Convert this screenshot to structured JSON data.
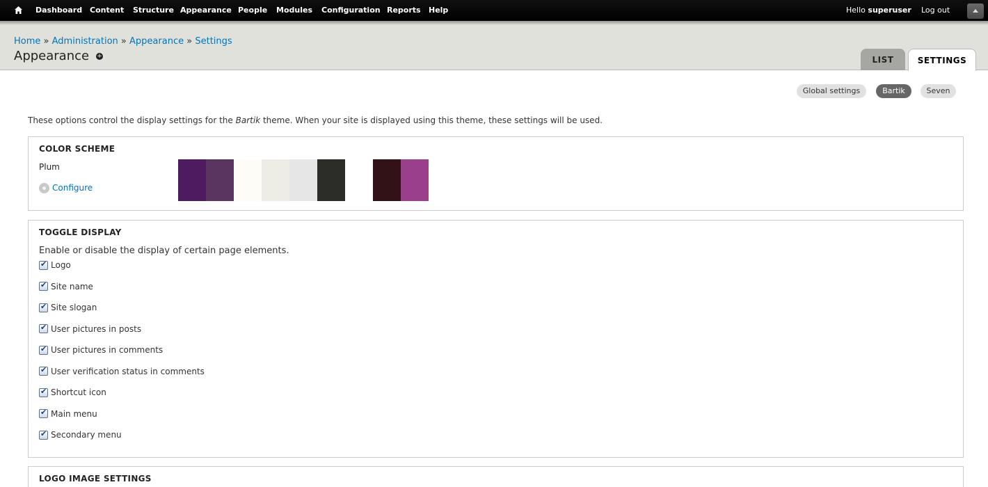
{
  "toolbar": {
    "menu": [
      "Dashboard",
      "Content",
      "Structure",
      "Appearance",
      "People",
      "Modules",
      "Configuration",
      "Reports",
      "Help"
    ],
    "hello_prefix": "Hello",
    "username": "superuser",
    "logout": "Log out"
  },
  "breadcrumb": [
    "Home",
    "Administration",
    "Appearance",
    "Settings"
  ],
  "breadcrumb_sep": "»",
  "page_title": "Appearance",
  "tabs": [
    "LIST",
    "SETTINGS"
  ],
  "subtabs": [
    "Global settings",
    "Bartik",
    "Seven"
  ],
  "intro": {
    "before": "These options control the display settings for the ",
    "theme": "Bartik",
    "after": " theme. When your site is displayed using this theme, these settings will be used."
  },
  "color_scheme": {
    "legend": "COLOR SCHEME",
    "name": "Plum",
    "configure": "Configure",
    "swatches": [
      "#4e1b60",
      "#5a3560",
      "#fdfcf6",
      "#edede6",
      "#e6e6e6",
      "#2c2d28",
      "#ffffff",
      "#321216",
      "#9a3f8c"
    ]
  },
  "toggle_display": {
    "legend": "TOGGLE DISPLAY",
    "description": "Enable or disable the display of certain page elements.",
    "items": [
      {
        "label": "Logo",
        "checked": true
      },
      {
        "label": "Site name",
        "checked": true
      },
      {
        "label": "Site slogan",
        "checked": true
      },
      {
        "label": "User pictures in posts",
        "checked": true
      },
      {
        "label": "User pictures in comments",
        "checked": true
      },
      {
        "label": "User verification status in comments",
        "checked": true
      },
      {
        "label": "Shortcut icon",
        "checked": true
      },
      {
        "label": "Main menu",
        "checked": true
      },
      {
        "label": "Secondary menu",
        "checked": true
      }
    ]
  },
  "logo_settings": {
    "legend": "LOGO IMAGE SETTINGS"
  }
}
